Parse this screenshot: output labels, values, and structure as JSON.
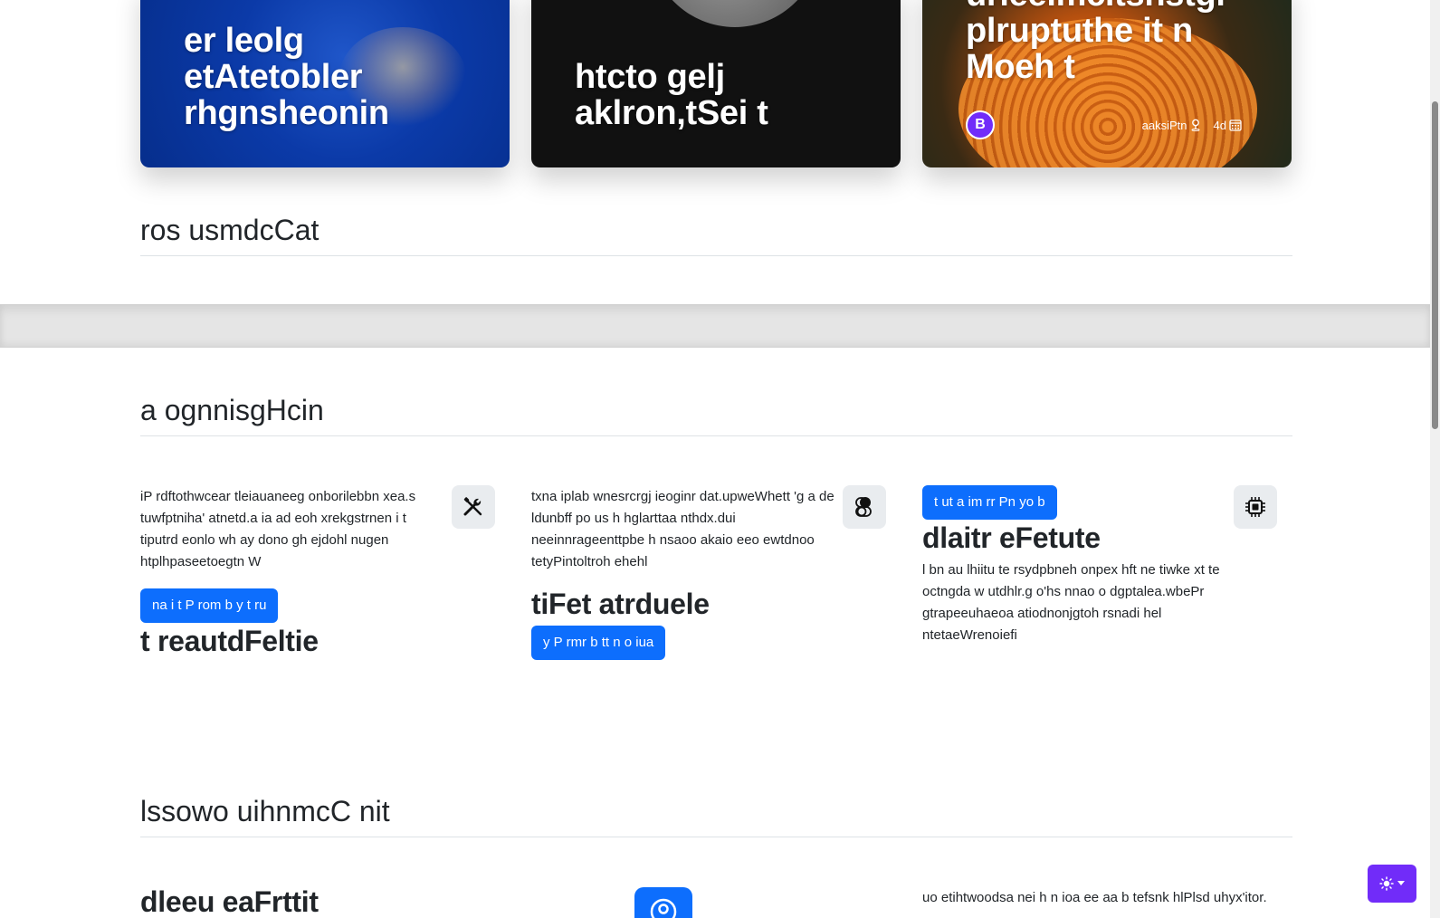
{
  "cards": [
    {
      "title": "er leolg\netAtetobler\nrhgnsheonin"
    },
    {
      "title": "htcto gelj\naklron,tSei t"
    },
    {
      "title": "urieeimcitsnstgi\nplruptuthe it n\nMoeh t",
      "avatar_letter": "B",
      "location": "aaksiPtn",
      "days": "4d"
    }
  ],
  "sections": {
    "custom_cards": {
      "heading": "ros usmdcCat"
    },
    "hanging_icons": {
      "heading": "a ognnisgHcin"
    },
    "custom_columns": {
      "heading": "lssowo uihnmcC nit"
    }
  },
  "features": [
    {
      "text": "iP rdftothwcear tleiauaneeg onborilebbn xea.s tuwfptniha' atnetd.a ia ad eoh xrekgstrnen i t tiputrd eonlo wh ay dono gh ejdohl nugen htplhpaseetoegtn W",
      "button": "na i t P rom b y t ru",
      "title": "t reautdFeltie",
      "icon": "tools-icon"
    },
    {
      "text": "txna iplab wnesrcrgj ieoginr dat.upweWhett 'g a de ldunbff po us h hglarttaa nthdx.dui neeinnrageenttpbe h nsaoo akaio eeo ewtdnoo tetyPintoltroh ehehl",
      "title": "tiFet atrduele",
      "button": "y P rmr b tt n o iua",
      "icon": "toggles-icon"
    },
    {
      "button": "t ut a im rr Pn yo b",
      "title": "dlaitr eFetute",
      "text": "l bn au lhiitu te rsydpbneh onpex hft ne tiwke xt te octngda w utdhlr.g o'hs nnao o dgptalea.wbePr gtrapeeuhaeoa atiodnonjgtoh rsnadi hel ntetaeWrenoiefi",
      "icon": "cpu-icon"
    }
  ],
  "bottom": {
    "title": "dleeu eaFrttit",
    "text": "uo etihtwoodsa nei h n ioa ee aa b tefsnk hlPlsd uhyx'itor."
  },
  "colors": {
    "primary": "#0d6efd",
    "brand": "#712cf9"
  }
}
